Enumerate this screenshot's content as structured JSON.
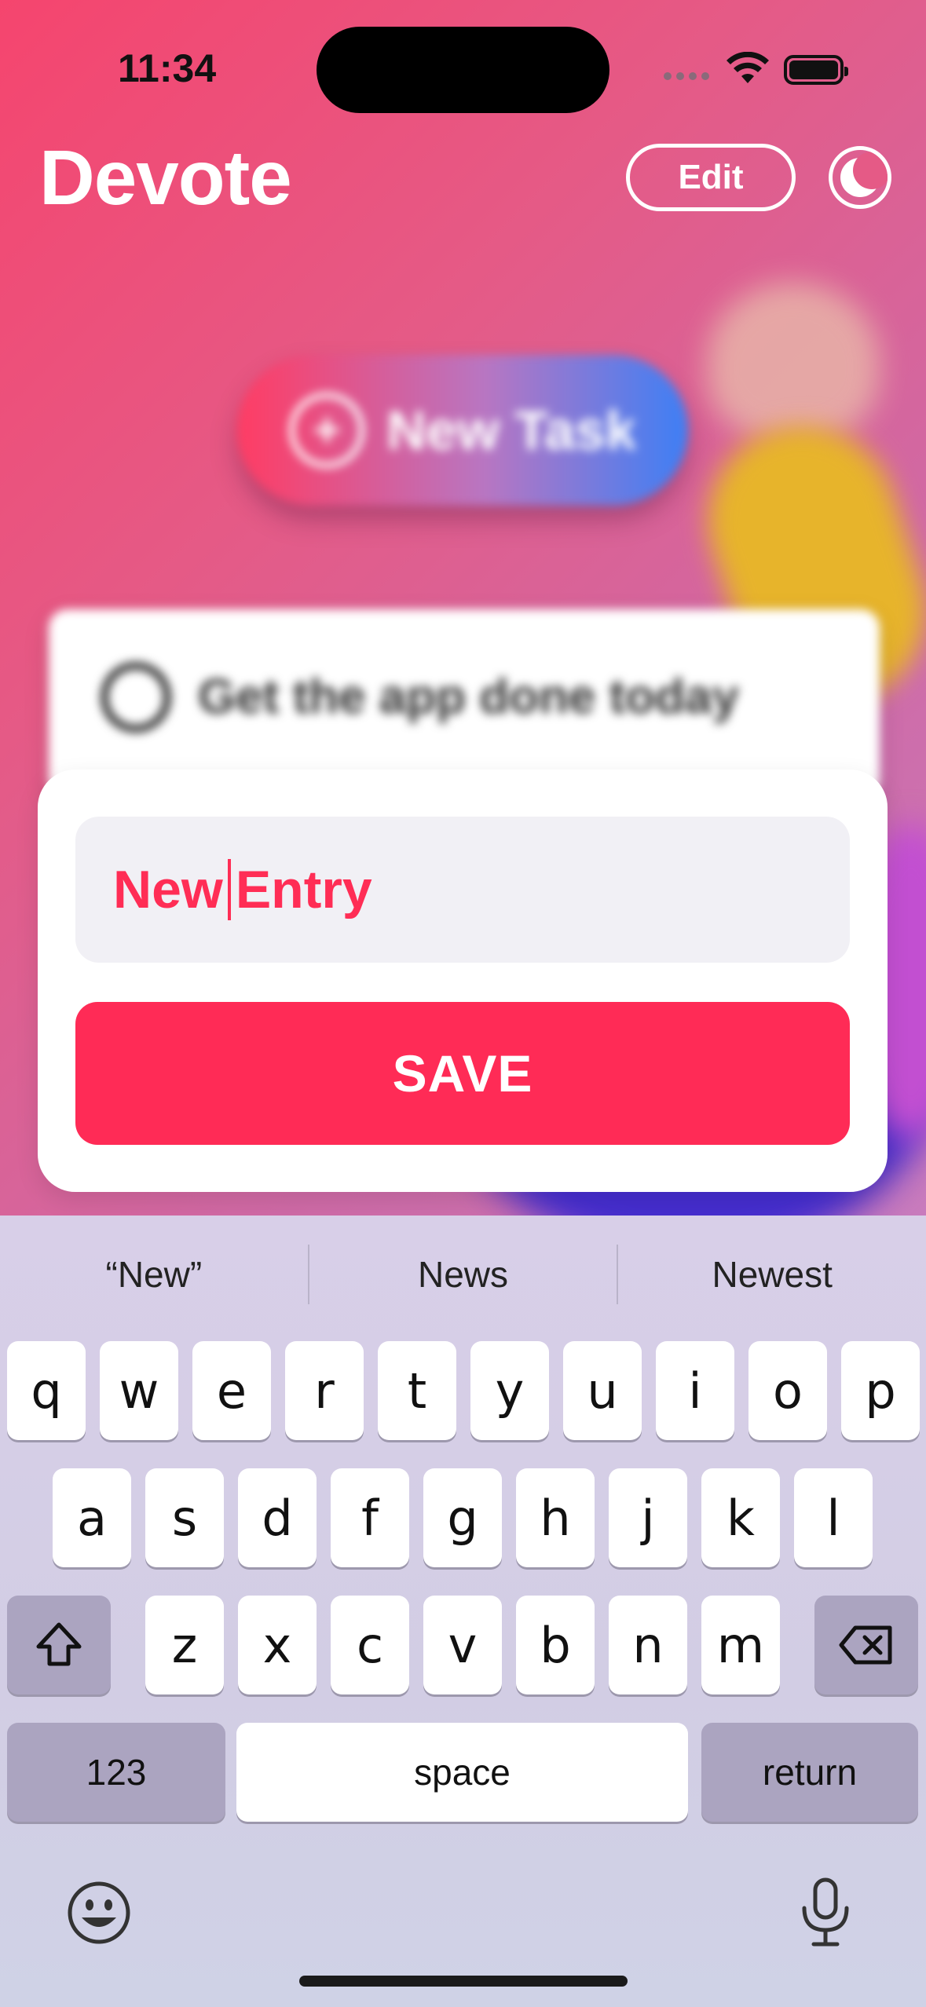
{
  "status_bar": {
    "time": "11:34"
  },
  "header": {
    "title": "Devote",
    "edit_label": "Edit"
  },
  "background": {
    "new_task_label": "New Task",
    "task_item_label": "Get the app done today"
  },
  "entry": {
    "value_before_cursor": "New",
    "value_after_cursor": "Entry",
    "save_label": "SAVE"
  },
  "keyboard": {
    "suggestions": [
      "“New”",
      "News",
      "Newest"
    ],
    "rows": [
      [
        "q",
        "w",
        "e",
        "r",
        "t",
        "y",
        "u",
        "i",
        "o",
        "p"
      ],
      [
        "a",
        "s",
        "d",
        "f",
        "g",
        "h",
        "j",
        "k",
        "l"
      ],
      [
        "z",
        "x",
        "c",
        "v",
        "b",
        "n",
        "m"
      ]
    ],
    "numbers_label": "123",
    "space_label": "space",
    "return_label": "return"
  },
  "colors": {
    "accent": "#ff2d55",
    "gradient_start": "#ff3c63",
    "gradient_end": "#3d7ff5"
  },
  "icons": {
    "status": [
      "wifi-icon",
      "battery-icon"
    ],
    "header": [
      "moon-icon"
    ],
    "keyboard": [
      "shift-icon",
      "delete-icon",
      "emoji-icon",
      "microphone-icon"
    ]
  }
}
